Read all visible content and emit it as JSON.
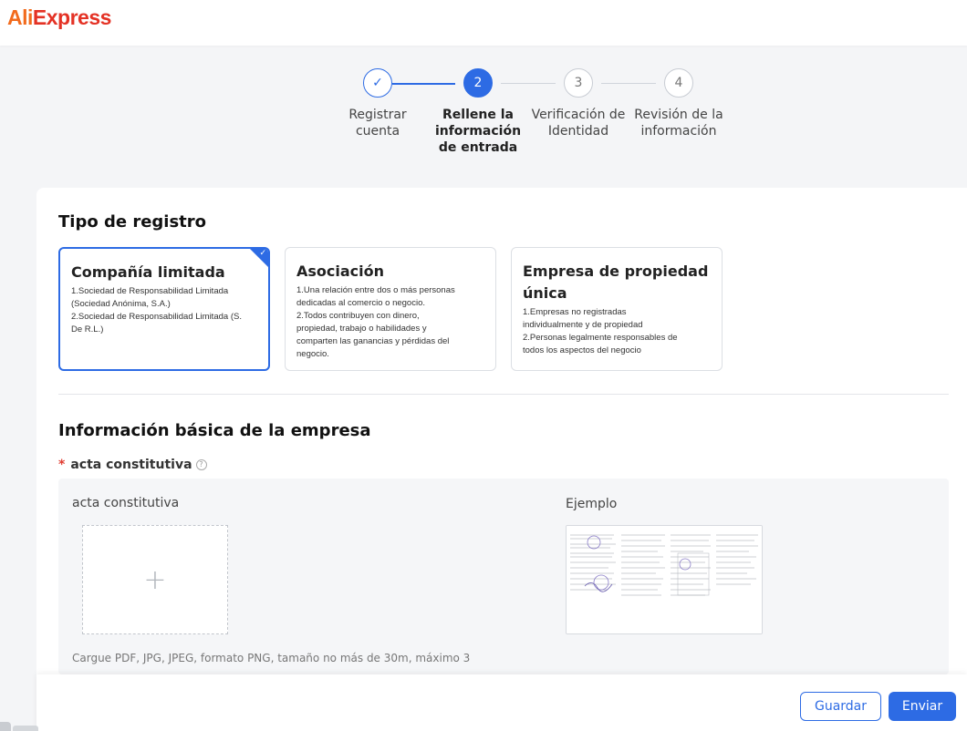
{
  "brand": {
    "logo_prefix": "Ali",
    "logo_suffix": "Express"
  },
  "stepper": {
    "steps": [
      {
        "number": "✓",
        "label": "Registrar\ncuenta",
        "status": "done"
      },
      {
        "number": "2",
        "label": "Rellene la\ninformación\nde entrada",
        "status": "active"
      },
      {
        "number": "3",
        "label": "Verificación de\nIdentidad",
        "status": "pending"
      },
      {
        "number": "4",
        "label": "Revisión de la\ninformación",
        "status": "pending"
      }
    ]
  },
  "registration_type": {
    "title": "Tipo de registro",
    "options": [
      {
        "name": "Compañía limitada",
        "description": "1.Sociedad de Responsabilidad Limitada\n(Sociedad Anónima, S.A.)\n2.Sociedad de Responsabilidad Limitada (S.\nDe R.L.)",
        "selected": true
      },
      {
        "name": "Asociación",
        "description": "1.Una relación entre dos o más personas\ndedicadas al comercio o negocio.\n2.Todos contribuyen con dinero,\npropiedad, trabajo o habilidades y\ncomparten las ganancias y pérdidas del\nnegocio.",
        "selected": false
      },
      {
        "name": "Empresa de propiedad\núnica",
        "description": "1.Empresas no registradas\nindividualmente y de propiedad\n2.Personas legalmente responsables de\ntodos los aspectos del negocio",
        "selected": false
      }
    ]
  },
  "basic_info": {
    "title": "Información básica de la empresa",
    "field": {
      "required_mark": "*",
      "label": "acta constitutiva",
      "help_icon": "?",
      "upload_title": "acta constitutiva",
      "example_title": "Ejemplo",
      "hint": "Cargue PDF, JPG, JPEG, formato PNG, tamaño no más de 30m, máximo 3",
      "plus_symbol": "+"
    }
  },
  "footer": {
    "save_label": "Guardar",
    "submit_label": "Enviar"
  },
  "colors": {
    "accent": "#2d6be4",
    "brand_red": "#e43225",
    "brand_orange": "#f26b1d"
  }
}
